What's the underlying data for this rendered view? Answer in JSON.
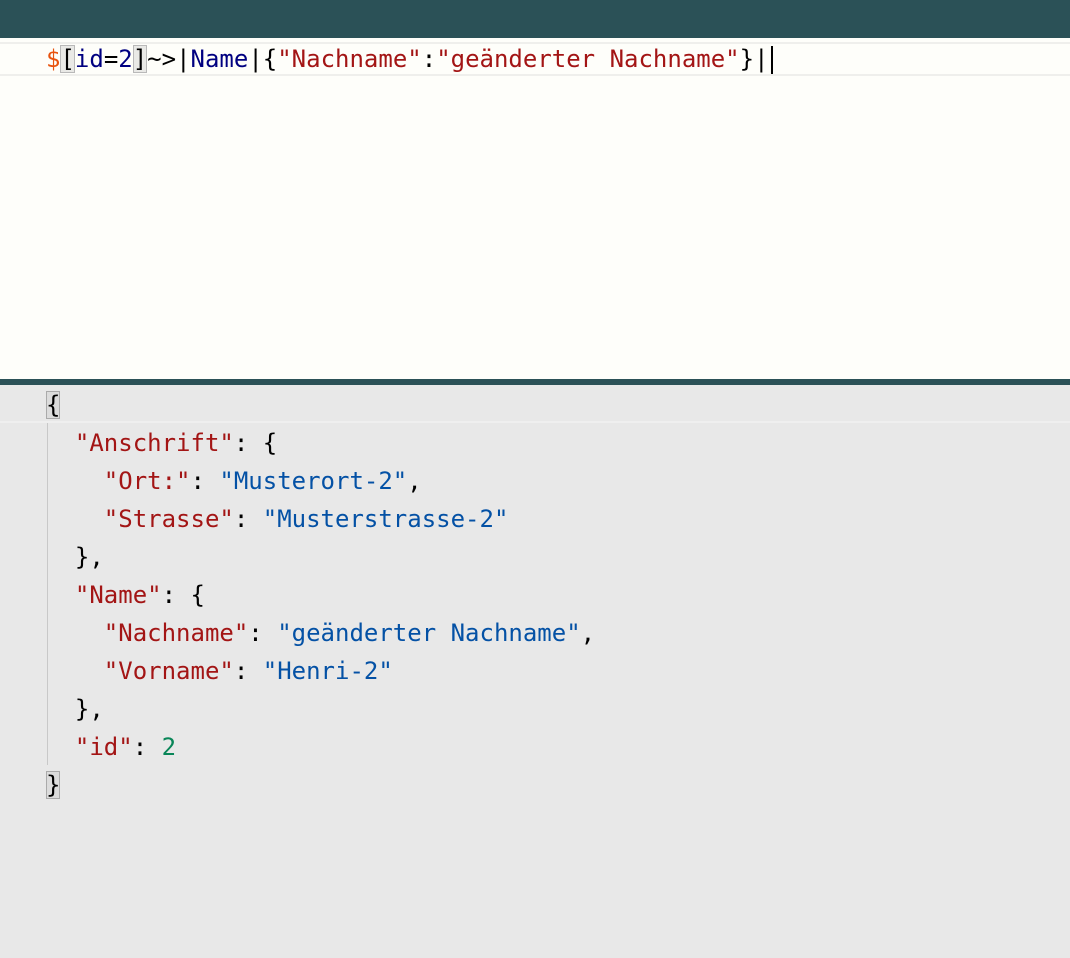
{
  "query": {
    "dollar": "$",
    "open_bracket": "[",
    "filter_field": "id",
    "filter_op": "=",
    "filter_value": "2",
    "close_bracket": "]",
    "arrow": "~>",
    "pipe1": "|",
    "path": "Name",
    "pipe2": "|",
    "open_brace": "{",
    "object_key": "\"Nachname\"",
    "colon": ":",
    "object_value": "\"geänderter Nachname\"",
    "close_brace": "}",
    "pipe3": "|"
  },
  "result": {
    "lines": [
      {
        "indent": "",
        "key": "",
        "sep": "",
        "value": "",
        "value_type": "",
        "punct": "{"
      },
      {
        "indent": "  ",
        "key": "\"Anschrift\"",
        "sep": ": ",
        "value": "",
        "value_type": "",
        "punct": "{"
      },
      {
        "indent": "    ",
        "key": "\"Ort:\"",
        "sep": ": ",
        "value": "\"Musterort-2\"",
        "value_type": "string",
        "punct": ","
      },
      {
        "indent": "    ",
        "key": "\"Strasse\"",
        "sep": ": ",
        "value": "\"Musterstrasse-2\"",
        "value_type": "string",
        "punct": ""
      },
      {
        "indent": "  ",
        "key": "",
        "sep": "",
        "value": "",
        "value_type": "",
        "punct": "},"
      },
      {
        "indent": "  ",
        "key": "\"Name\"",
        "sep": ": ",
        "value": "",
        "value_type": "",
        "punct": "{"
      },
      {
        "indent": "    ",
        "key": "\"Nachname\"",
        "sep": ": ",
        "value": "\"geänderter Nachname\"",
        "value_type": "string",
        "punct": ","
      },
      {
        "indent": "    ",
        "key": "\"Vorname\"",
        "sep": ": ",
        "value": "\"Henri-2\"",
        "value_type": "string",
        "punct": ""
      },
      {
        "indent": "  ",
        "key": "",
        "sep": "",
        "value": "",
        "value_type": "",
        "punct": "},"
      },
      {
        "indent": "  ",
        "key": "\"id\"",
        "sep": ": ",
        "value": "2",
        "value_type": "number",
        "punct": ""
      },
      {
        "indent": "",
        "key": "",
        "sep": "",
        "value": "",
        "value_type": "",
        "punct": "}"
      }
    ]
  },
  "colors": {
    "header_bar": "#2b5157",
    "editor_bg": "#fefefa",
    "output_bg": "#e8e8e8",
    "dollar": "#e8530e",
    "keyword": "#0000ff",
    "string": "#a31515",
    "json_value": "#0451a5",
    "json_number": "#098658"
  }
}
